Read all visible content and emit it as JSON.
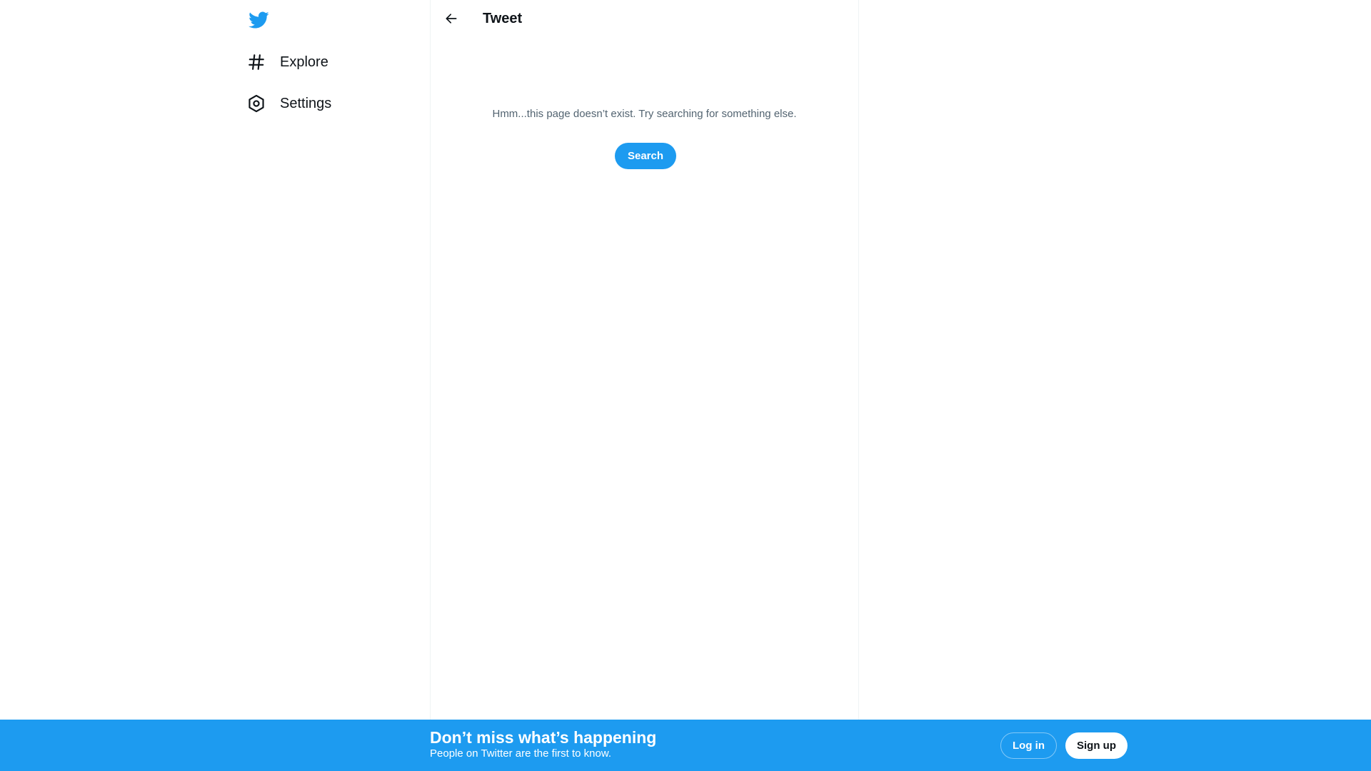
{
  "app": {
    "logo_icon": "twitter-bird-icon",
    "accent_color": "#1d9bf0"
  },
  "sidebar": {
    "items": [
      {
        "label": "Explore",
        "icon": "hashtag-icon"
      },
      {
        "label": "Settings",
        "icon": "gear-icon"
      }
    ]
  },
  "main": {
    "back_icon": "arrow-left-icon",
    "title": "Tweet",
    "empty_message": "Hmm...this page doesn’t exist. Try searching for something else.",
    "search_label": "Search"
  },
  "banner": {
    "title": "Don’t miss what’s happening",
    "subtitle": "People on Twitter are the first to know.",
    "login_label": "Log in",
    "signup_label": "Sign up",
    "background_color": "#1d9bf0"
  }
}
